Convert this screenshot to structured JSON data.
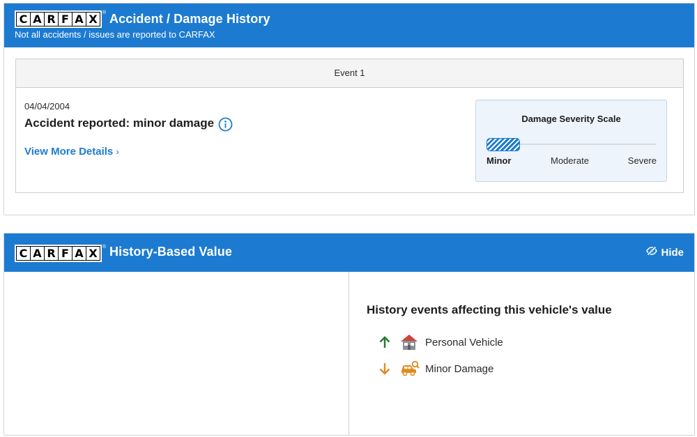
{
  "accident_card": {
    "logo_letters": [
      "C",
      "A",
      "R",
      "F",
      "A",
      "X"
    ],
    "logo_reg": "®",
    "title": "Accident / Damage History",
    "subtitle": "Not all accidents / issues are reported to CARFAX",
    "event": {
      "heading": "Event 1",
      "date": "04/04/2004",
      "title": "Accident reported: minor damage",
      "link_label": "View More Details",
      "link_chevron": "›"
    },
    "severity": {
      "title": "Damage Severity Scale",
      "levels": [
        "Minor",
        "Moderate",
        "Severe"
      ],
      "selected": "Minor",
      "selected_index": 0,
      "fill_color": "#1c7bd1"
    }
  },
  "value_card": {
    "logo_letters": [
      "C",
      "A",
      "R",
      "F",
      "A",
      "X"
    ],
    "logo_reg": "®",
    "title": "History-Based Value",
    "hide_label": "Hide",
    "events_title": "History events affecting this vehicle's value",
    "events": [
      {
        "label": "Personal Vehicle",
        "direction": "up",
        "arrow_color": "#1f7a2a",
        "icon": "house-icon"
      },
      {
        "label": "Minor Damage",
        "direction": "down",
        "arrow_color": "#e08a1e",
        "icon": "car-damage-icon"
      }
    ]
  },
  "colors": {
    "brand_blue": "#1c7bd1",
    "up_green": "#1f7a2a",
    "down_orange": "#e08a1e"
  }
}
